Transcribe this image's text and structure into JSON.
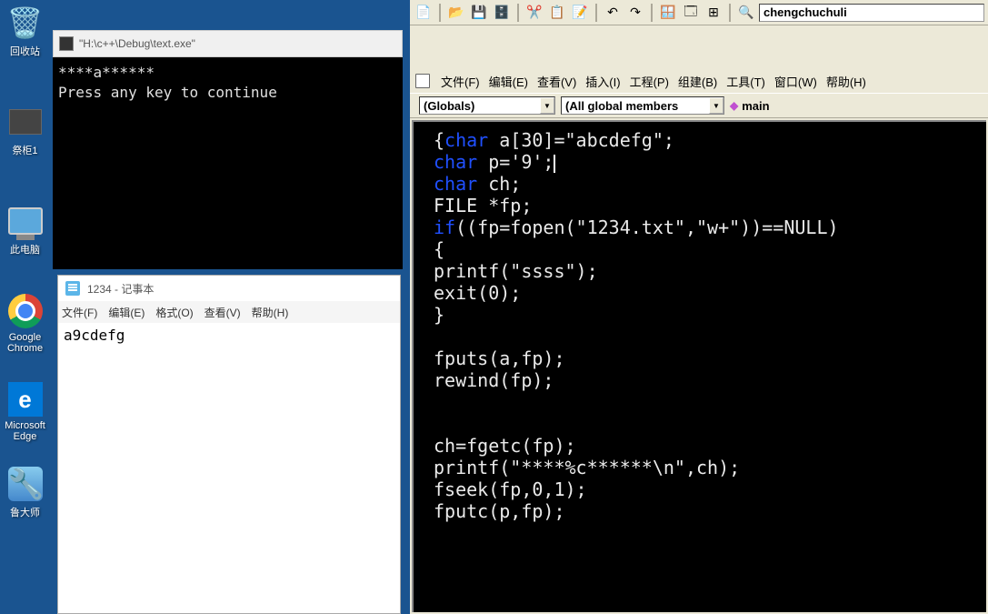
{
  "desktop": {
    "recycle_bin": "回收站",
    "item2": "祭柜1",
    "this_pc": "此电脑",
    "chrome": "Google Chrome",
    "edge": "Microsoft Edge",
    "ludashi": "鲁大师"
  },
  "console": {
    "title": "\"H:\\c++\\Debug\\text.exe\"",
    "output": "****a******\nPress any key to continue"
  },
  "notepad": {
    "title": "1234 - 记事本",
    "menu": {
      "file": "文件(F)",
      "edit": "编辑(E)",
      "format": "格式(O)",
      "view": "查看(V)",
      "help": "帮助(H)"
    },
    "content": "a9cdefg"
  },
  "ide": {
    "toolbar": {
      "textbox": "chengchuchuli"
    },
    "menu": {
      "file": "文件(F)",
      "edit": "编辑(E)",
      "view": "查看(V)",
      "insert": "插入(I)",
      "project": "工程(P)",
      "build": "组建(B)",
      "tool": "工具(T)",
      "window": "窗口(W)",
      "help": "帮助(H)"
    },
    "combos": {
      "scope": "(Globals)",
      "members": "(All global members",
      "func": "main"
    },
    "code_tokens": [
      {
        "t": "txt",
        "v": "{"
      },
      {
        "t": "kw",
        "v": "char"
      },
      {
        "t": "txt",
        "v": " a[30]=\"abcdefg\";"
      },
      {
        "t": "nl"
      },
      {
        "t": "kw",
        "v": "char"
      },
      {
        "t": "txt",
        "v": " p='9';"
      },
      {
        "t": "cur"
      },
      {
        "t": "nl"
      },
      {
        "t": "kw",
        "v": "char"
      },
      {
        "t": "txt",
        "v": " ch;"
      },
      {
        "t": "nl"
      },
      {
        "t": "txt",
        "v": "FILE *fp;"
      },
      {
        "t": "nl"
      },
      {
        "t": "kw",
        "v": "if"
      },
      {
        "t": "txt",
        "v": "((fp=fopen(\"1234.txt\",\"w+\"))==NULL)"
      },
      {
        "t": "nl"
      },
      {
        "t": "txt",
        "v": "{"
      },
      {
        "t": "nl"
      },
      {
        "t": "txt",
        "v": "printf(\"ssss\");"
      },
      {
        "t": "nl"
      },
      {
        "t": "txt",
        "v": "exit(0);"
      },
      {
        "t": "nl"
      },
      {
        "t": "txt",
        "v": "}"
      },
      {
        "t": "nl"
      },
      {
        "t": "nl"
      },
      {
        "t": "txt",
        "v": "fputs(a,fp);"
      },
      {
        "t": "nl"
      },
      {
        "t": "txt",
        "v": "rewind(fp);"
      },
      {
        "t": "nl"
      },
      {
        "t": "nl"
      },
      {
        "t": "nl"
      },
      {
        "t": "txt",
        "v": "ch=fgetc(fp);"
      },
      {
        "t": "nl"
      },
      {
        "t": "txt",
        "v": "printf(\"****%c******\\n\",ch);"
      },
      {
        "t": "nl"
      },
      {
        "t": "txt",
        "v": "fseek(fp,0,1);"
      },
      {
        "t": "nl"
      },
      {
        "t": "txt",
        "v": "fputc(p,fp);"
      },
      {
        "t": "nl"
      }
    ]
  }
}
